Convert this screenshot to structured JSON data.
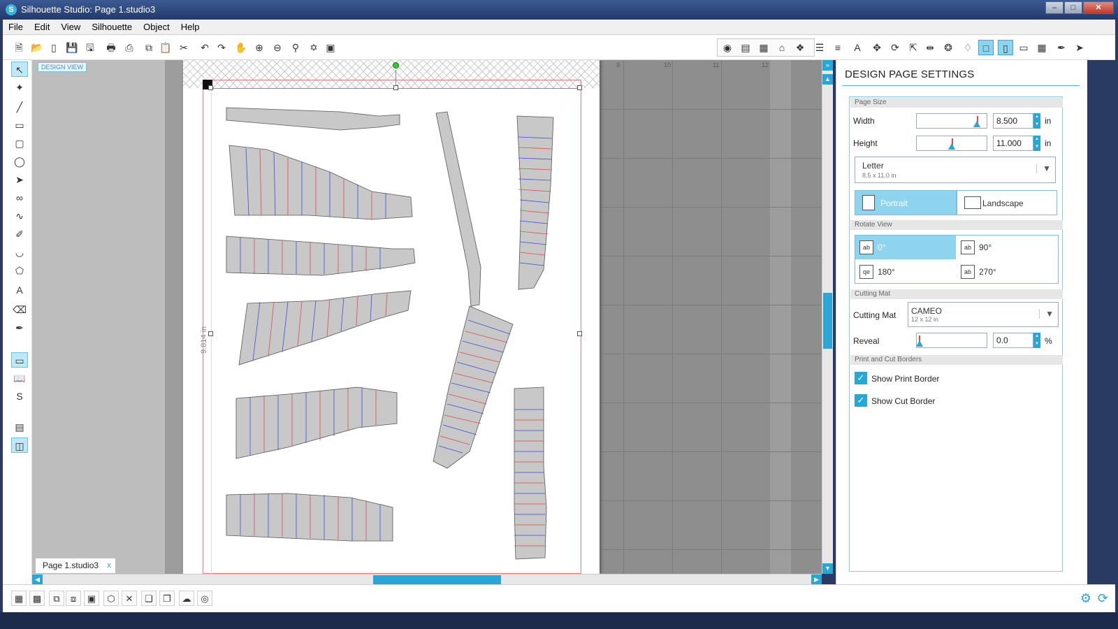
{
  "window": {
    "title": "Silhouette Studio: Page 1.studio3"
  },
  "menu": [
    "File",
    "Edit",
    "View",
    "Silhouette",
    "Object",
    "Help"
  ],
  "workspace": {
    "design_view_label": "DESIGN VIEW",
    "height_dimension": "9.814 in",
    "mat_numbers": [
      "9",
      "10",
      "11",
      "12"
    ],
    "doc_tab": "Page 1.studio3",
    "doc_tab_close": "x"
  },
  "panel": {
    "title": "DESIGN PAGE SETTINGS",
    "page_size": {
      "section": "Page Size",
      "width_label": "Width",
      "width_value": "8.500",
      "width_slider_level": 0.86,
      "height_label": "Height",
      "height_value": "11.000",
      "height_slider_level": 0.5,
      "unit": "in",
      "size_name": "Letter",
      "size_sub": "8.5 x 11.0 in",
      "portrait": "Portrait",
      "landscape": "Landscape",
      "orientation": "Portrait"
    },
    "rotate_view": {
      "section": "Rotate View",
      "options": [
        "0°",
        "90°",
        "180°",
        "270°"
      ],
      "selected": "0°"
    },
    "cutting_mat": {
      "section": "Cutting Mat",
      "label": "Cutting Mat",
      "mat_name": "CAMEO",
      "mat_size": "12 x 12 in",
      "reveal_label": "Reveal",
      "reveal_value": "0.0",
      "reveal_unit": "%"
    },
    "borders": {
      "section": "Print and Cut Borders",
      "show_print_border": "Show Print Border",
      "show_cut_border": "Show Cut Border",
      "print_checked": true,
      "cut_checked": true
    }
  },
  "colors": {
    "accent": "#2aa6d6",
    "selected_fill": "#8fd4ee",
    "cut_line": "#e04a4a",
    "fold_line": "#3a4fd6"
  }
}
